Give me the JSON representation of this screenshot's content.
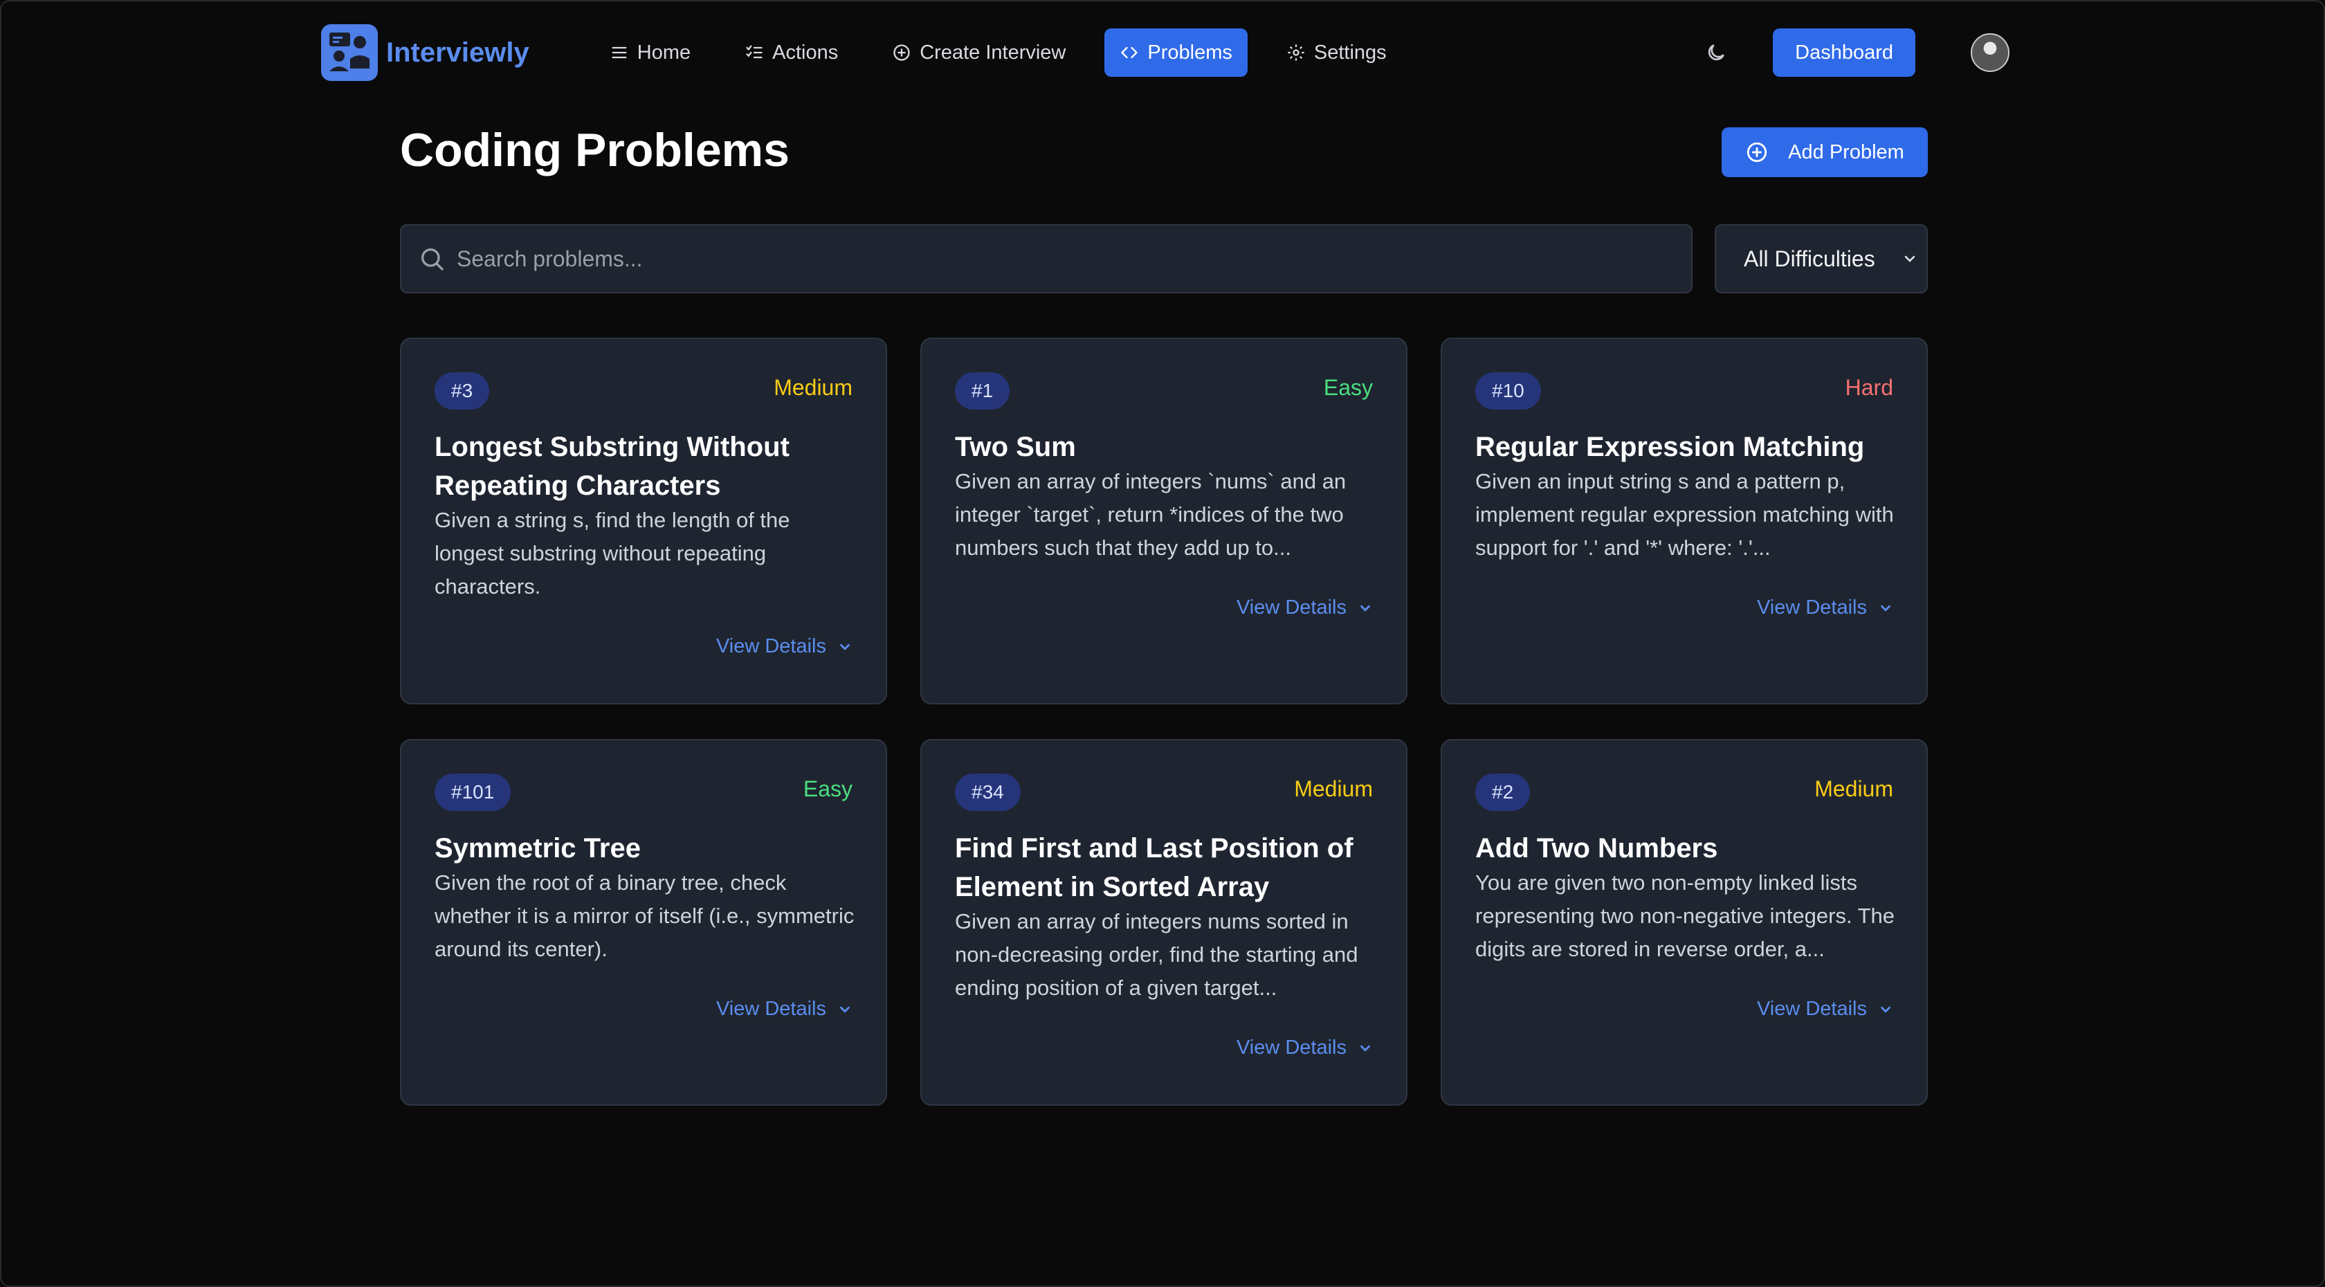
{
  "brand": {
    "name": "Interviewly"
  },
  "nav": {
    "items": [
      {
        "label": "Home",
        "icon": "menu-icon"
      },
      {
        "label": "Actions",
        "icon": "list-check-icon"
      },
      {
        "label": "Create Interview",
        "icon": "plus-circle-icon"
      },
      {
        "label": "Problems",
        "icon": "code-icon",
        "active": true
      },
      {
        "label": "Settings",
        "icon": "gear-icon"
      }
    ],
    "dashboard_label": "Dashboard",
    "theme_icon": "moon-icon"
  },
  "page": {
    "title": "Coding Problems",
    "add_label": "Add Problem"
  },
  "search": {
    "placeholder": "Search problems..."
  },
  "filter": {
    "selected": "All Difficulties"
  },
  "colors": {
    "accent": "#2f6ae8",
    "easy": "#4ade80",
    "medium": "#facc15",
    "hard": "#f87171"
  },
  "problems": [
    {
      "id": "#3",
      "difficulty": "Medium",
      "title": "Longest Substring Without Repeating Characters",
      "description": "Given a string s, find the length of the longest substring without repeating characters.",
      "link": "View Details"
    },
    {
      "id": "#1",
      "difficulty": "Easy",
      "title": "Two Sum",
      "description": "Given an array of integers `nums` and an integer `target`, return *indices of the two numbers such that they add up to...",
      "link": "View Details"
    },
    {
      "id": "#10",
      "difficulty": "Hard",
      "title": "Regular Expression Matching",
      "description": "Given an input string s and a pattern p, implement regular expression matching with support for '.' and '*' where: '.'...",
      "link": "View Details"
    },
    {
      "id": "#101",
      "difficulty": "Easy",
      "title": "Symmetric Tree",
      "description": "Given the root of a binary tree, check whether it is a mirror of itself (i.e., symmetric around its center).",
      "link": "View Details"
    },
    {
      "id": "#34",
      "difficulty": "Medium",
      "title": "Find First and Last Position of Element in Sorted Array",
      "description": "Given an array of integers nums sorted in non-decreasing order, find the starting and ending position of a given target...",
      "link": "View Details"
    },
    {
      "id": "#2",
      "difficulty": "Medium",
      "title": "Add Two Numbers",
      "description": "You are given two non-empty linked lists representing two non-negative integers. The digits are stored in reverse order, a...",
      "link": "View Details"
    }
  ]
}
